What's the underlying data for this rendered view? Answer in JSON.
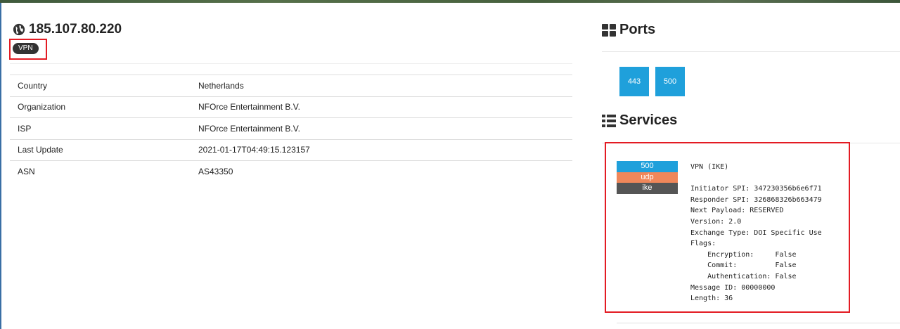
{
  "host": {
    "ip": "185.107.80.220",
    "tag": "VPN"
  },
  "info_rows": [
    {
      "key": "Country",
      "value": "Netherlands"
    },
    {
      "key": "Organization",
      "value": "NFOrce Entertainment B.V."
    },
    {
      "key": "ISP",
      "value": "NFOrce Entertainment B.V."
    },
    {
      "key": "Last Update",
      "value": "2021-01-17T04:49:15.123157"
    },
    {
      "key": "ASN",
      "value": "AS43350"
    }
  ],
  "ports": {
    "title": "Ports",
    "icon": "grid-icon",
    "items": [
      "443",
      "500"
    ]
  },
  "services": {
    "title": "Services",
    "icon": "list-icon",
    "entry": {
      "port": "500",
      "protocol": "udp",
      "name": "ike",
      "banner": [
        "VPN (IKE)",
        "",
        "Initiator SPI: 347230356b6e6f71",
        "Responder SPI: 326868326b663479",
        "Next Payload: RESERVED",
        "Version: 2.0",
        "Exchange Type: DOI Specific Use",
        "Flags:",
        "    Encryption:     False",
        "    Commit:         False",
        "    Authentication: False",
        "Message ID: 00000000",
        "Length: 36"
      ]
    }
  },
  "colors": {
    "accent_blue": "#1fa0db",
    "udp_orange": "#f0875a",
    "name_gray": "#555555",
    "highlight_red": "#e31b23"
  }
}
